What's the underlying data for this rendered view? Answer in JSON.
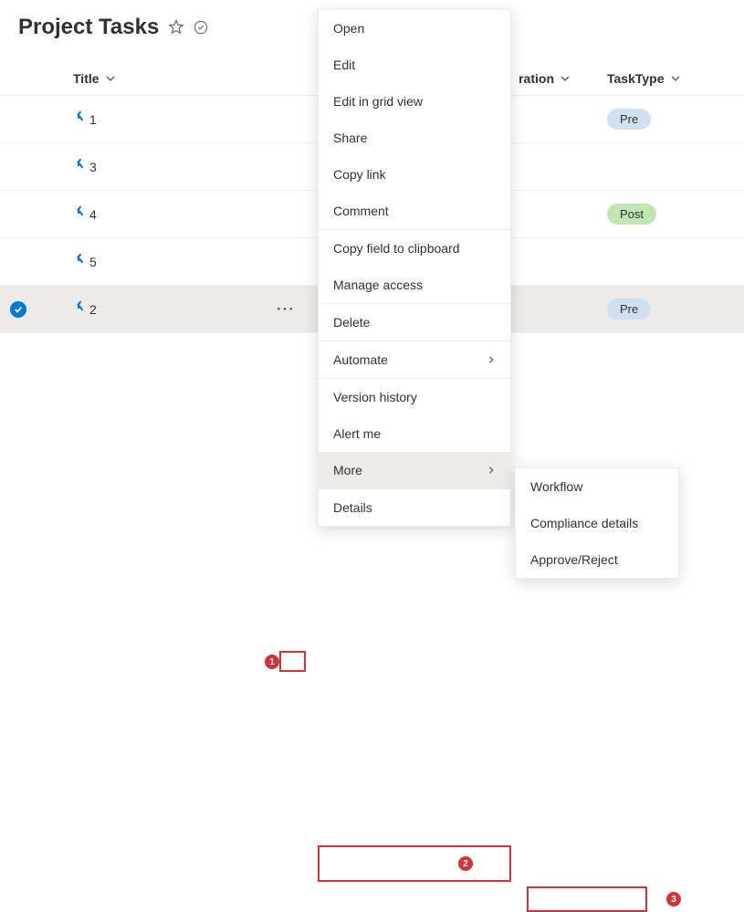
{
  "header": {
    "title": "Project Tasks"
  },
  "columns": {
    "title": "Title",
    "duration": "ration",
    "tasktype": "TaskType"
  },
  "rows": [
    {
      "title": "1",
      "tasktype": "Pre",
      "selected": false
    },
    {
      "title": "3",
      "tasktype": "",
      "selected": false
    },
    {
      "title": "4",
      "tasktype": "Post",
      "selected": false
    },
    {
      "title": "5",
      "tasktype": "",
      "selected": false
    },
    {
      "title": "2",
      "tasktype": "Pre",
      "selected": true
    }
  ],
  "menu": {
    "open": "Open",
    "edit": "Edit",
    "edit_grid": "Edit in grid view",
    "share": "Share",
    "copy_link": "Copy link",
    "comment": "Comment",
    "copy_field": "Copy field to clipboard",
    "manage_access": "Manage access",
    "delete": "Delete",
    "automate": "Automate",
    "version_history": "Version history",
    "alert_me": "Alert me",
    "more": "More",
    "details": "Details"
  },
  "submenu": {
    "workflow": "Workflow",
    "compliance": "Compliance details",
    "approve_reject": "Approve/Reject"
  },
  "annotations": {
    "a1": "1",
    "a2": "2",
    "a3": "3"
  }
}
